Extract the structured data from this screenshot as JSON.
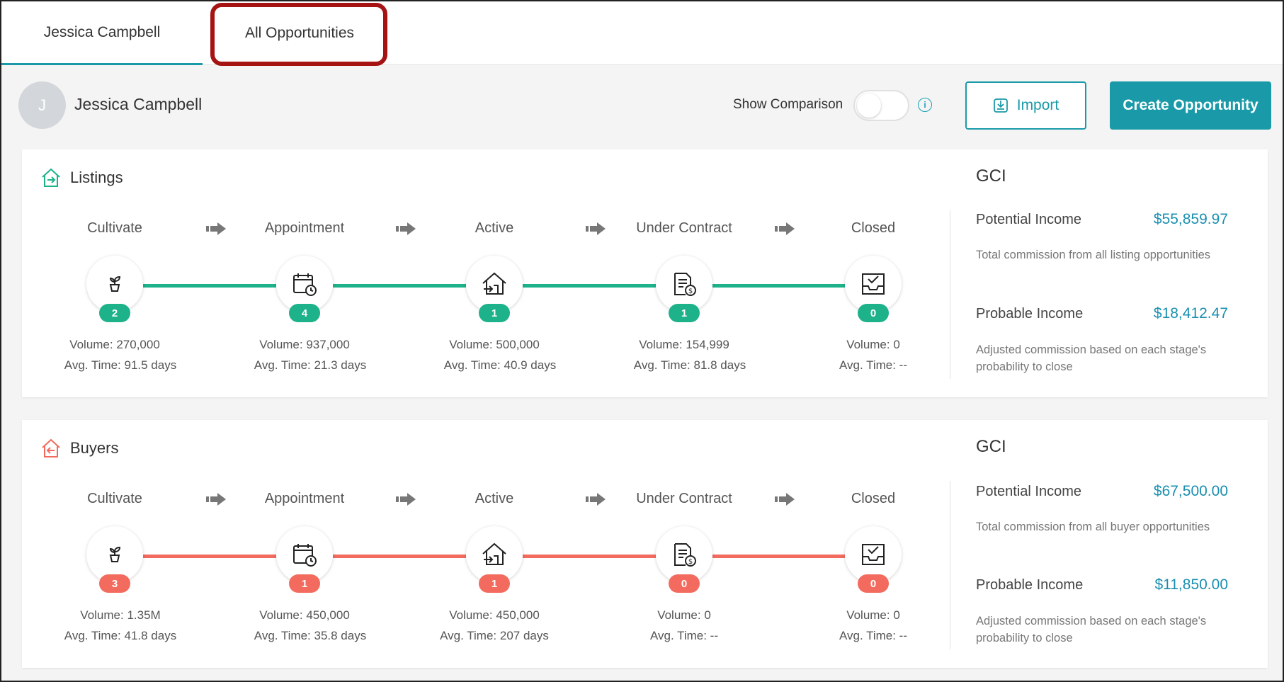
{
  "tabs": [
    {
      "label": "Jessica Campbell"
    },
    {
      "label": "All Opportunities"
    }
  ],
  "header": {
    "avatar_initial": "J",
    "user_name": "Jessica Campbell",
    "show_comparison_label": "Show Comparison",
    "info_icon": "info-icon",
    "import_label": "Import",
    "create_label": "Create Opportunity"
  },
  "colors": {
    "accent": "#1a9aa8",
    "listings": "#1db28a",
    "buyers": "#f26b5e",
    "highlight": "#a51313",
    "value_text": "#1a8fb0"
  },
  "sections": [
    {
      "title": "Listings",
      "icon": "listing-house-icon",
      "stages": [
        {
          "label": "Cultivate",
          "icon": "sprout-icon",
          "count": "2",
          "volume": "Volume: 270,000",
          "avg": "Avg. Time: 91.5 days"
        },
        {
          "label": "Appointment",
          "icon": "calendar-clock-icon",
          "count": "4",
          "volume": "Volume: 937,000",
          "avg": "Avg. Time: 21.3 days"
        },
        {
          "label": "Active",
          "icon": "house-arrow-icon",
          "count": "1",
          "volume": "Volume: 500,000",
          "avg": "Avg. Time: 40.9 days"
        },
        {
          "label": "Under Contract",
          "icon": "contract-dollar-icon",
          "count": "1",
          "volume": "Volume: 154,999",
          "avg": "Avg. Time: 81.8 days"
        },
        {
          "label": "Closed",
          "icon": "inbox-check-icon",
          "count": "0",
          "volume": "Volume: 0",
          "avg": "Avg. Time: --"
        }
      ],
      "gci": {
        "title": "GCI",
        "potential_label": "Potential Income",
        "potential_value": "$55,859.97",
        "potential_desc": "Total commission from all listing opportunities",
        "probable_label": "Probable Income",
        "probable_value": "$18,412.47",
        "probable_desc": "Adjusted commission based on each stage's probability to close"
      }
    },
    {
      "title": "Buyers",
      "icon": "buyer-house-icon",
      "stages": [
        {
          "label": "Cultivate",
          "icon": "sprout-icon",
          "count": "3",
          "volume": "Volume: 1.35M",
          "avg": "Avg. Time: 41.8 days"
        },
        {
          "label": "Appointment",
          "icon": "calendar-clock-icon",
          "count": "1",
          "volume": "Volume: 450,000",
          "avg": "Avg. Time: 35.8 days"
        },
        {
          "label": "Active",
          "icon": "house-arrow-icon",
          "count": "1",
          "volume": "Volume: 450,000",
          "avg": "Avg. Time: 207 days"
        },
        {
          "label": "Under Contract",
          "icon": "contract-dollar-icon",
          "count": "0",
          "volume": "Volume: 0",
          "avg": "Avg. Time: --"
        },
        {
          "label": "Closed",
          "icon": "inbox-check-icon",
          "count": "0",
          "volume": "Volume: 0",
          "avg": "Avg. Time: --"
        }
      ],
      "gci": {
        "title": "GCI",
        "potential_label": "Potential Income",
        "potential_value": "$67,500.00",
        "potential_desc": "Total commission from all buyer opportunities",
        "probable_label": "Probable Income",
        "probable_value": "$11,850.00",
        "probable_desc": "Adjusted commission based on each stage's probability to close"
      }
    }
  ]
}
